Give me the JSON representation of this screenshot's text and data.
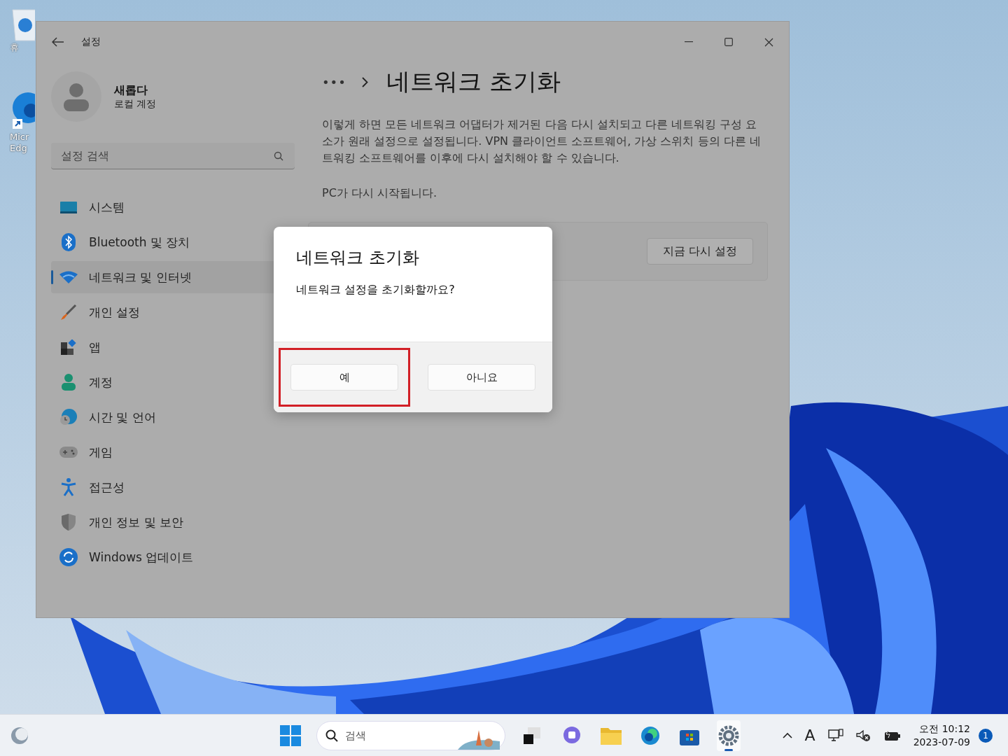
{
  "desktop": {
    "icons": [
      {
        "kind": "recycle",
        "lines": [
          "휴"
        ]
      },
      {
        "kind": "edge",
        "lines": [
          "Micr",
          "Edg"
        ]
      }
    ]
  },
  "window": {
    "title": "설정"
  },
  "user": {
    "name": "새롭다",
    "account_type": "로컬 계정"
  },
  "search": {
    "placeholder": "설정 검색"
  },
  "nav": [
    {
      "label": "시스템",
      "selected": false
    },
    {
      "label": "Bluetooth 및 장치",
      "selected": false
    },
    {
      "label": "네트워크 및 인터넷",
      "selected": true
    },
    {
      "label": "개인 설정",
      "selected": false
    },
    {
      "label": "앱",
      "selected": false
    },
    {
      "label": "계정",
      "selected": false
    },
    {
      "label": "시간 및 언어",
      "selected": false
    },
    {
      "label": "게임",
      "selected": false
    },
    {
      "label": "접근성",
      "selected": false
    },
    {
      "label": "개인 정보 및 보안",
      "selected": false
    },
    {
      "label": "Windows 업데이트",
      "selected": false
    }
  ],
  "page": {
    "breadcrumb_more": "•••",
    "title": "네트워크 초기화",
    "description": "이렇게 하면 모든 네트워크 어댑터가 제거된 다음 다시 설치되고 다른 네트워킹 구성 요소가 원래 설정으로 설정됩니다. VPN 클라이언트 소프트웨어, 가상 스위치 등의 다른 네트워킹 소프트웨어를 이후에 다시 설치해야 할 수 있습니다.",
    "note": "PC가 다시 시작됩니다.",
    "reset_button": "지금 다시 설정"
  },
  "dialog": {
    "title": "네트워크 초기화",
    "message": "네트워크 설정을 초기화할까요?",
    "buttons": [
      {
        "label": "예",
        "highlighted": true
      },
      {
        "label": "아니요",
        "highlighted": false
      }
    ]
  },
  "taskbar": {
    "search_placeholder": "검색",
    "apps": [
      {
        "kind": "terminal",
        "selected": false
      },
      {
        "kind": "chat",
        "selected": false
      },
      {
        "kind": "folder",
        "selected": false
      },
      {
        "kind": "edge",
        "selected": false
      },
      {
        "kind": "store",
        "selected": false
      },
      {
        "kind": "settings",
        "selected": true
      }
    ],
    "input_indicator": "A",
    "time": "오전 10:12",
    "date": "2023-07-09",
    "notification_count": "1"
  }
}
